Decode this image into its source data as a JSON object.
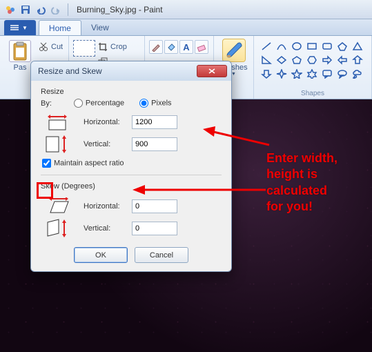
{
  "title": {
    "filename": "Burning_Sky.jpg",
    "app": "Paint"
  },
  "ribbon": {
    "tabs": {
      "file": "",
      "home": "Home",
      "view": "View"
    },
    "clipboard": {
      "paste": "Pas",
      "cut": "Cut",
      "group_label": ""
    },
    "image": {
      "crop": "Crop",
      "group_label": ""
    },
    "brushes": {
      "label": "Brushes"
    },
    "shapes": {
      "group_label": "Shapes"
    }
  },
  "dialog": {
    "title": "Resize and Skew",
    "resize": {
      "section": "Resize",
      "by": "By:",
      "percentage": "Percentage",
      "pixels": "Pixels",
      "horizontal_label": "Horizontal:",
      "vertical_label": "Vertical:",
      "horizontal_value": "1200",
      "vertical_value": "900",
      "maintain": "Maintain aspect ratio"
    },
    "skew": {
      "section": "Skew (Degrees)",
      "horizontal_label": "Horizontal:",
      "vertical_label": "Vertical:",
      "horizontal_value": "0",
      "vertical_value": "0"
    },
    "buttons": {
      "ok": "OK",
      "cancel": "Cancel"
    }
  },
  "annotation": {
    "line1": "Enter width,",
    "line2": "height is",
    "line3": "calculated",
    "line4": "for you!"
  }
}
